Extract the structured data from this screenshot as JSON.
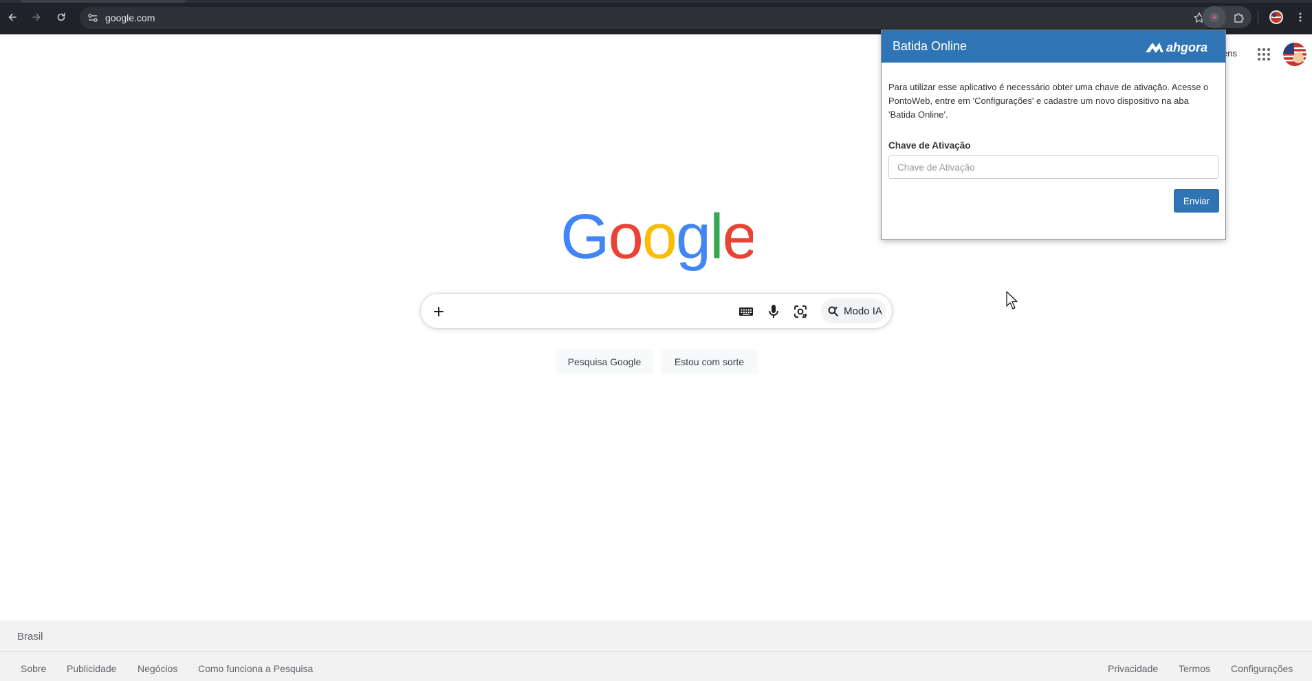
{
  "browser": {
    "url": "google.com",
    "colors": {
      "toolbar": "#1f2329",
      "omnibox": "#2e3238"
    }
  },
  "google": {
    "logo_text": "Google",
    "header_partial_text": "ens",
    "search": {
      "placeholder": "",
      "ai_mode_label": "Modo IA"
    },
    "buttons": {
      "search": "Pesquisa Google",
      "lucky": "Estou com sorte"
    },
    "footer": {
      "country": "Brasil",
      "left_links": [
        "Sobre",
        "Publicidade",
        "Negócios",
        "Como funciona a Pesquisa"
      ],
      "right_links": [
        "Privacidade",
        "Termos",
        "Configurações"
      ]
    },
    "logo_colors": {
      "blue": "#4285f4",
      "red": "#ea4335",
      "yellow": "#fbbc05",
      "green": "#34a853"
    }
  },
  "popup": {
    "title": "Batida Online",
    "brand": "ahgora",
    "description": "Para utilizar esse aplicativo é necessário obter uma chave de ativação. Acesse o PontoWeb, entre em 'Configurações' e cadastre um novo dispositivo na aba 'Batida Online'.",
    "field_label": "Chave de Ativação",
    "field_placeholder": "Chave de Ativação",
    "field_value": "",
    "submit_label": "Enviar",
    "accent": "#2f75b5"
  }
}
